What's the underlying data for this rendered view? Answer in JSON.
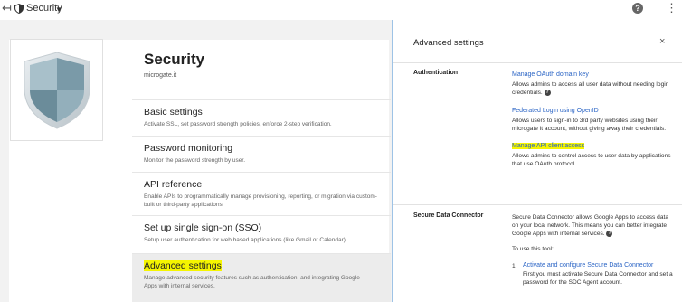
{
  "topbar": {
    "back_icon": "back-arrow-icon",
    "title": "Security",
    "more_icon": "⋮"
  },
  "page": {
    "title": "Security",
    "domain": "microgate.it"
  },
  "settings": [
    {
      "title": "Basic settings",
      "desc": "Activate SSL, set password strength policies, enforce 2-step verification."
    },
    {
      "title": "Password monitoring",
      "desc": "Monitor the password strength by user."
    },
    {
      "title": "API reference",
      "desc": "Enable APIs to programmatically manage provisioning, reporting, or migration via custom-built or third-party applications."
    },
    {
      "title": "Set up single sign-on (SSO)",
      "desc": "Setup user authentication for web based applications (like Gmail or Calendar)."
    },
    {
      "title": "Advanced settings",
      "desc": "Manage advanced security features such as authentication, and integrating Google Apps with internal services."
    }
  ],
  "panel": {
    "title": "Advanced settings",
    "close": "×",
    "authentication": {
      "label": "Authentication",
      "items": [
        {
          "link": "Manage OAuth domain key",
          "desc": "Allows admins to access all user data without needing login credentials."
        },
        {
          "link": "Federated Login using OpenID",
          "desc": "Allows users to sign-in to 3rd party websites using their microgate it account, without giving away their credentials."
        },
        {
          "link": "Manage API client access",
          "desc": "Allows admins to control access to user data by applications that use OAuth protocol."
        }
      ]
    },
    "sdc": {
      "label": "Secure Data Connector",
      "desc": "Secure Data Connector allows Google Apps to access data on your local network. This means you can better integrate Google Apps with internal services.",
      "to_use": "To use this tool:",
      "step_num": "1.",
      "step_link": "Activate and configure Secure Data Connector",
      "step_desc": "First you must activate Secure Data Connector and set a password for the SDC Agent account."
    }
  },
  "colors": {
    "link": "#2a64c5",
    "highlight": "#f5f500",
    "panel_border": "#9ec3e6"
  }
}
